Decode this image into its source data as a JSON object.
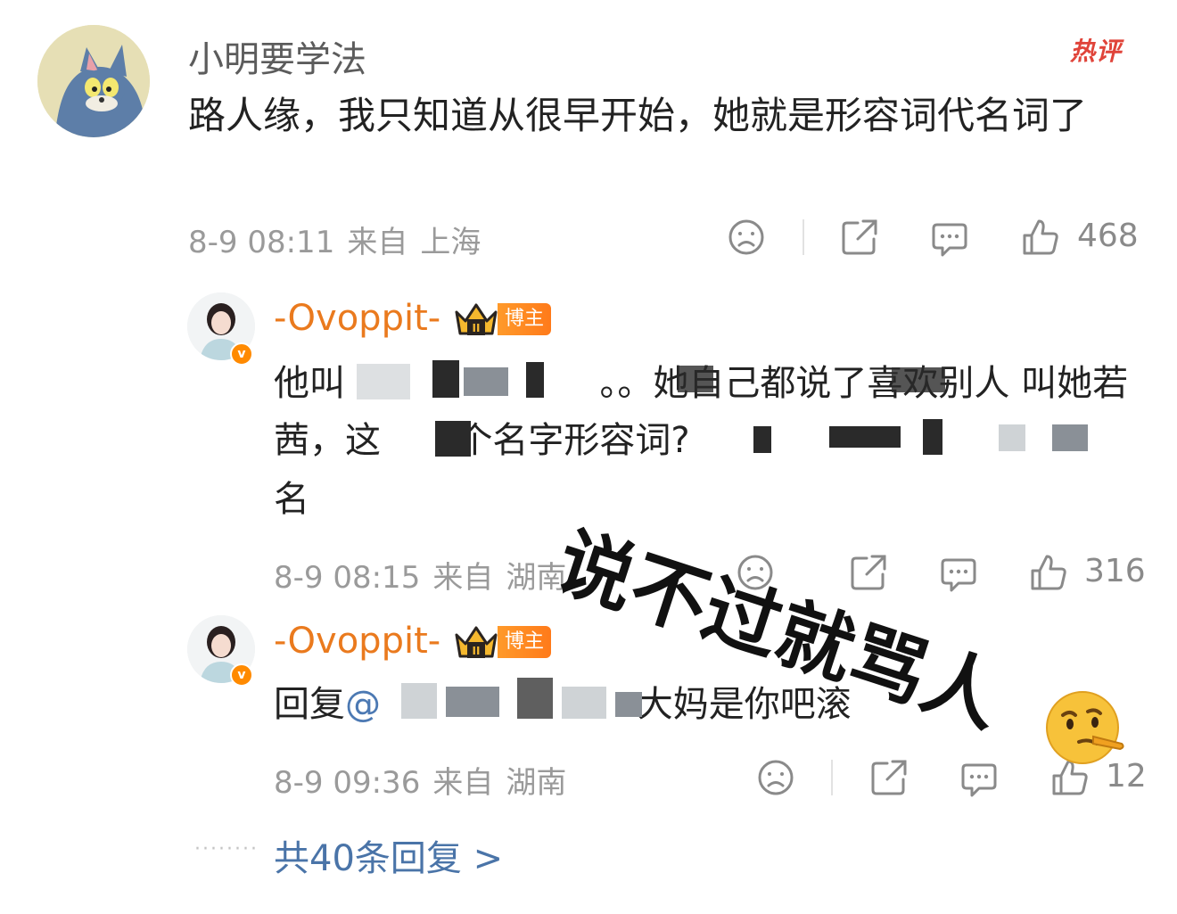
{
  "comment": {
    "username": "小明要学法",
    "hot_label": "热评",
    "text": "路人缘，我只知道从很早开始，她就是形容词代名词了",
    "meta": {
      "date": "8-9 08:11",
      "from": "来自",
      "location": "上海"
    },
    "likes": "468"
  },
  "replies": [
    {
      "username": "-Ovoppit-",
      "tag": "博主",
      "crown_level": "II",
      "text_line1_start": "他叫",
      "text_line1_mid": "。。她自己都说了喜欢别人",
      "text_line1_end": "叫她若",
      "text_line2_start": "茜，这",
      "text_line2_mid": "个名字形容词?",
      "text_line2_end": "",
      "text_line3": "名",
      "meta": {
        "date": "8-9 08:15",
        "from": "来自",
        "location": "湖南"
      },
      "likes": "316"
    },
    {
      "username": "-Ovoppit-",
      "tag": "博主",
      "crown_level": "II",
      "reply_prefix": "回复",
      "mention_at": "@",
      "text_end": ".大妈是你吧滚",
      "meta": {
        "date": "8-9 09:36",
        "from": "来自",
        "location": "湖南"
      },
      "likes": "12"
    }
  ],
  "more_replies": "共40条回复 >",
  "overlay": "说不过就骂人",
  "icons": [
    "sad-face-icon",
    "share-icon",
    "comment-icon",
    "thumbs-up-icon",
    "thinking-face-emoji"
  ],
  "colors": {
    "username_orange": "#ea7a1e",
    "link_blue": "#4a74a8",
    "hot_red": "#e0443a"
  }
}
